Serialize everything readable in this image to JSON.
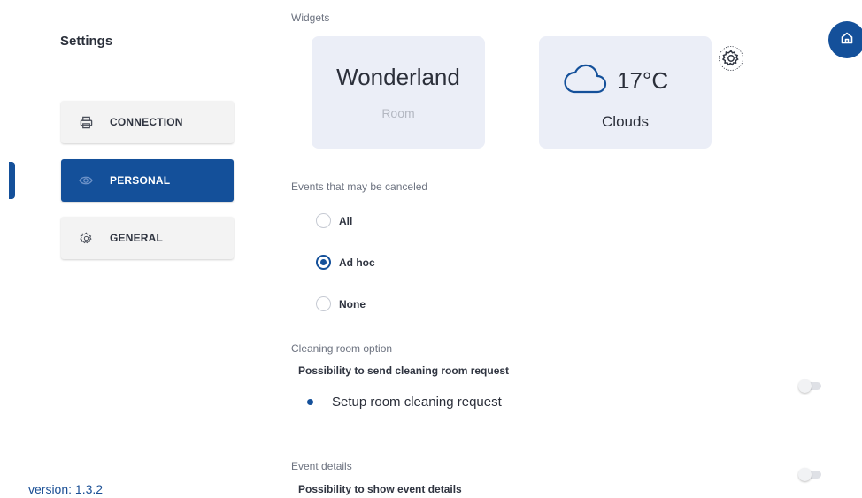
{
  "sidebar": {
    "title": "Settings",
    "items": [
      {
        "label": "CONNECTION",
        "icon": "printer-icon",
        "active": false
      },
      {
        "label": "PERSONAL",
        "icon": "eye-icon",
        "active": true
      },
      {
        "label": "GENERAL",
        "icon": "gear-icon",
        "active": false
      }
    ],
    "version": "version: 1.3.2"
  },
  "widgets": {
    "section_label": "Widgets",
    "room": {
      "name": "Wonderland",
      "subtitle": "Room"
    },
    "weather": {
      "temperature": "17°C",
      "description": "Clouds",
      "icon": "cloud-icon"
    }
  },
  "events_cancel": {
    "label": "Events that may be canceled",
    "options": [
      {
        "label": "All",
        "checked": false
      },
      {
        "label": "Ad hoc",
        "checked": true
      },
      {
        "label": "None",
        "checked": false
      }
    ]
  },
  "cleaning": {
    "section_label": "Cleaning room option",
    "description": "Possibility to send cleaning room request",
    "item_label": "Setup room cleaning request",
    "enabled": false
  },
  "event_details": {
    "section_label": "Event details",
    "description": "Possibility to show event details",
    "enabled": false
  },
  "colors": {
    "accent": "#14509a",
    "card_bg": "#ebeef7",
    "nav_bg": "#f3f3f3"
  }
}
